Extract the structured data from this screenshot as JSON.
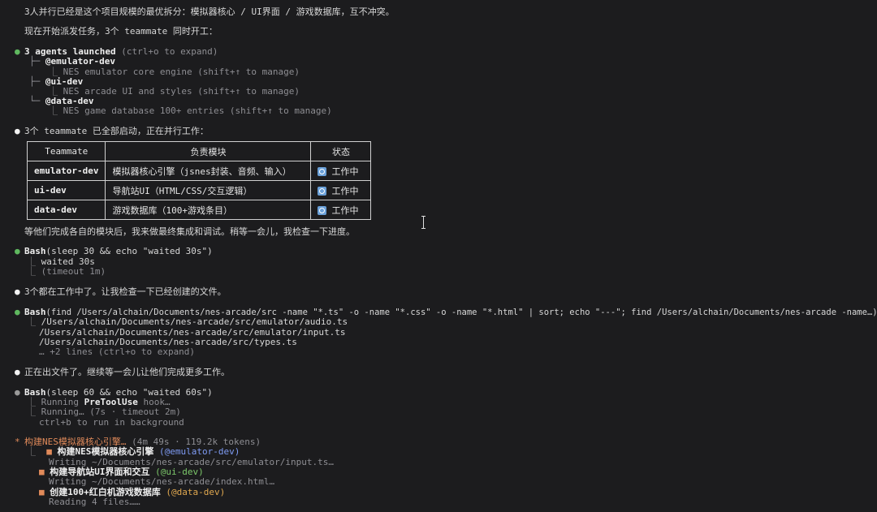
{
  "lines": {
    "l1": "3人并行已经是这个项目规模的最优拆分：模拟器核心 / UI界面 / 游戏数据库，互不冲突。",
    "l2": "现在开始派发任务，3个 teammate 同时开工：",
    "agents_title": "3 agents launched",
    "agents_hint": " (ctrl+o to expand)",
    "a1_name": "@emulator-dev",
    "a1_desc": "NES emulator core engine (shift+↑ to manage)",
    "a2_name": "@ui-dev",
    "a2_desc": "NES arcade UI and styles (shift+↑ to manage)",
    "a3_name": "@data-dev",
    "a3_desc": "NES game database 100+ entries (shift+↑ to manage)",
    "started": "3个 teammate 已全部启动，正在并行工作：",
    "wait_msg": "等他们完成各自的模块后，我来做最终集成和调试。稍等一会儿，我检查一下进度。",
    "bash1": "Bash",
    "bash1_args": "(sleep 30 && echo \"waited 30s\")",
    "bash1_out1": "waited 30s",
    "bash1_out2": "(timeout 1m)",
    "check_msg": "3个都在工作中了。让我检查一下已经创建的文件。",
    "bash2": "Bash",
    "bash2_args": "(find /Users/alchain/Documents/nes-arcade/src -name \"*.ts\" -o -name \"*.css\" -o -name \"*.html\" | sort; echo \"---\"; find /Users/alchain/Documents/nes-arcade -name…)",
    "f1": "/Users/alchain/Documents/nes-arcade/src/emulator/audio.ts",
    "f2": "/Users/alchain/Documents/nes-arcade/src/emulator/input.ts",
    "f3": "/Users/alchain/Documents/nes-arcade/src/types.ts",
    "f_more": "… +2 lines (ctrl+o to expand)",
    "files_msg": "正在出文件了。继续等一会儿让他们完成更多工作。",
    "bash3": "Bash",
    "bash3_args": "(sleep 60 && echo \"waited 60s\")",
    "run1_pre": "Running ",
    "run1_hook": "PreToolUse",
    "run1_post": " hook…",
    "run2": "Running… (7s · timeout 2m)",
    "run3": "ctrl+b to run in background",
    "task_title": "构建NES模拟器核心引擎…",
    "task_meta": " (4m 49s · 119.2k tokens)",
    "t1_title": "构建NES模拟器核心引擎",
    "t1_agent": "(@emulator-dev)",
    "t1_sub": "Writing ~/Documents/nes-arcade/src/emulator/input.ts…",
    "t2_title": "构建导航站UI界面和交互",
    "t2_agent": "(@ui-dev)",
    "t2_sub": "Writing ~/Documents/nes-arcade/index.html…",
    "t3_title": "创建100+红白机游戏数据库",
    "t3_agent": "(@data-dev)",
    "t3_sub": "Reading 4 files……"
  },
  "table": {
    "headers": [
      "Teammate",
      "负责模块",
      "状态"
    ],
    "rows": [
      {
        "name": "emulator-dev",
        "module": "模拟器核心引擎（jsnes封装、音频、输入）",
        "status": "工作中"
      },
      {
        "name": "ui-dev",
        "module": "导航站UI（HTML/CSS/交互逻辑）",
        "status": "工作中"
      },
      {
        "name": "data-dev",
        "module": "游戏数据库（100+游戏条目）",
        "status": "工作中"
      }
    ]
  },
  "glyphs": {
    "dot": "●",
    "star": "*",
    "square": "■",
    "tree_mid": "├─",
    "tree_end": "└─",
    "elbow": "⎿"
  },
  "colors": {
    "background": "#1c1c1e",
    "green_dot": "#5fb85f",
    "orange": "#e08a5a",
    "blue_agent": "#7f9cf5",
    "green_agent": "#7cc86a",
    "amber_agent": "#e0a850"
  }
}
